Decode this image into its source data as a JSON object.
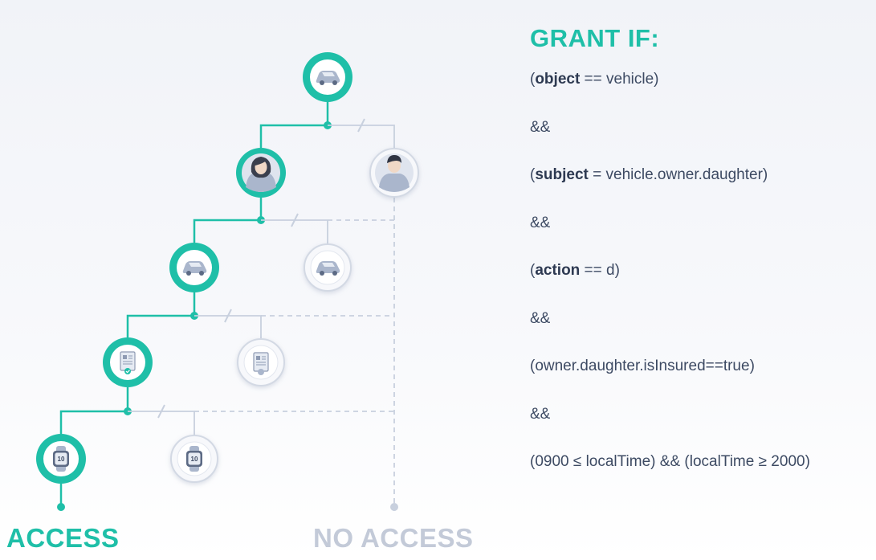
{
  "policy": {
    "title": "GRANT IF:",
    "rules": [
      {
        "open": "(",
        "keyword": "object",
        "rest": " == vehicle)"
      },
      {
        "open": "",
        "keyword": "",
        "rest": "&&"
      },
      {
        "open": "(",
        "keyword": "subject",
        "rest": " = vehicle.owner.daughter)"
      },
      {
        "open": "",
        "keyword": "",
        "rest": "&&"
      },
      {
        "open": "(",
        "keyword": "action",
        "rest": " == d)"
      },
      {
        "open": "",
        "keyword": "",
        "rest": "&&"
      },
      {
        "open": "",
        "keyword": "",
        "rest": "(owner.daughter.isInsured==true)"
      },
      {
        "open": "",
        "keyword": "",
        "rest": "&&"
      },
      {
        "open": "",
        "keyword": "",
        "rest": "(0900 ≤ localTime) && (localTime ≥ 2000)"
      }
    ]
  },
  "outcomes": {
    "access": "ACCESS",
    "no_access": "NO ACCESS"
  },
  "nodes": {
    "granted": [
      "car-icon",
      "daughter-avatar-icon",
      "car-icon",
      "insurance-document-icon",
      "watch-clock-icon"
    ],
    "denied": [
      "person-avatar-icon",
      "car-icon",
      "insurance-document-icon",
      "watch-clock-icon"
    ],
    "watch_text": "10"
  },
  "colors": {
    "accent": "#1fbfa8",
    "muted": "#c3cad8",
    "text": "#3d4a63"
  }
}
